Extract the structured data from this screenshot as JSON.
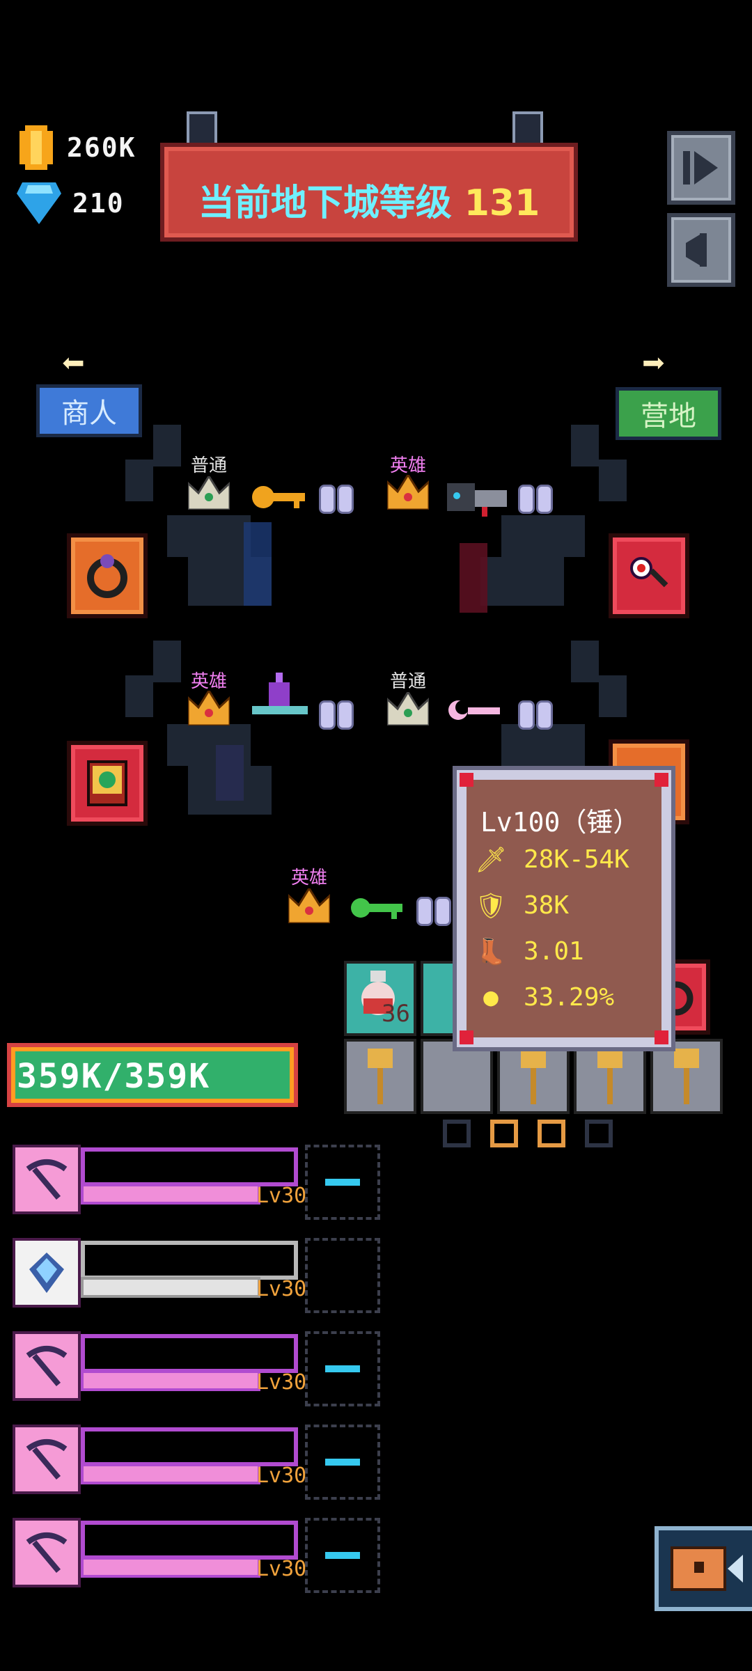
{
  "currency": {
    "gold": "260K",
    "diamonds": "210"
  },
  "banner": {
    "label": "当前地下城等级",
    "level": "131"
  },
  "top_buttons": {
    "exit": "exit-icon",
    "sound": "sound-icon"
  },
  "nav": {
    "left": "商人",
    "right": "营地"
  },
  "shelves": {
    "s1_rarity": "普通",
    "s2_rarity": "英雄",
    "s3_rarity": "英雄",
    "s4_rarity": "普通",
    "s5_rarity": "英雄"
  },
  "tooltip": {
    "title": "Lv100（锤）",
    "attack": "28K-54K",
    "defense": "38K",
    "speed": "3.01",
    "crit": "33.29%"
  },
  "hp": {
    "text": "359K/359K"
  },
  "hidden_counter": "36",
  "heroes": [
    {
      "level": "Lv30",
      "icon": "pickaxe-icon",
      "style": "pink"
    },
    {
      "level": "Lv30",
      "icon": "crystal-icon",
      "style": "white"
    },
    {
      "level": "Lv30",
      "icon": "pickaxe-icon",
      "style": "pink"
    },
    {
      "level": "Lv30",
      "icon": "pickaxe-icon",
      "style": "pink"
    },
    {
      "level": "Lv30",
      "icon": "pickaxe-icon",
      "style": "pink"
    }
  ],
  "colors": {
    "common": "#e7e7e7",
    "hero": "#f07ff0",
    "gold_text": "#ffe94a",
    "level_text": "#f0a23c"
  }
}
